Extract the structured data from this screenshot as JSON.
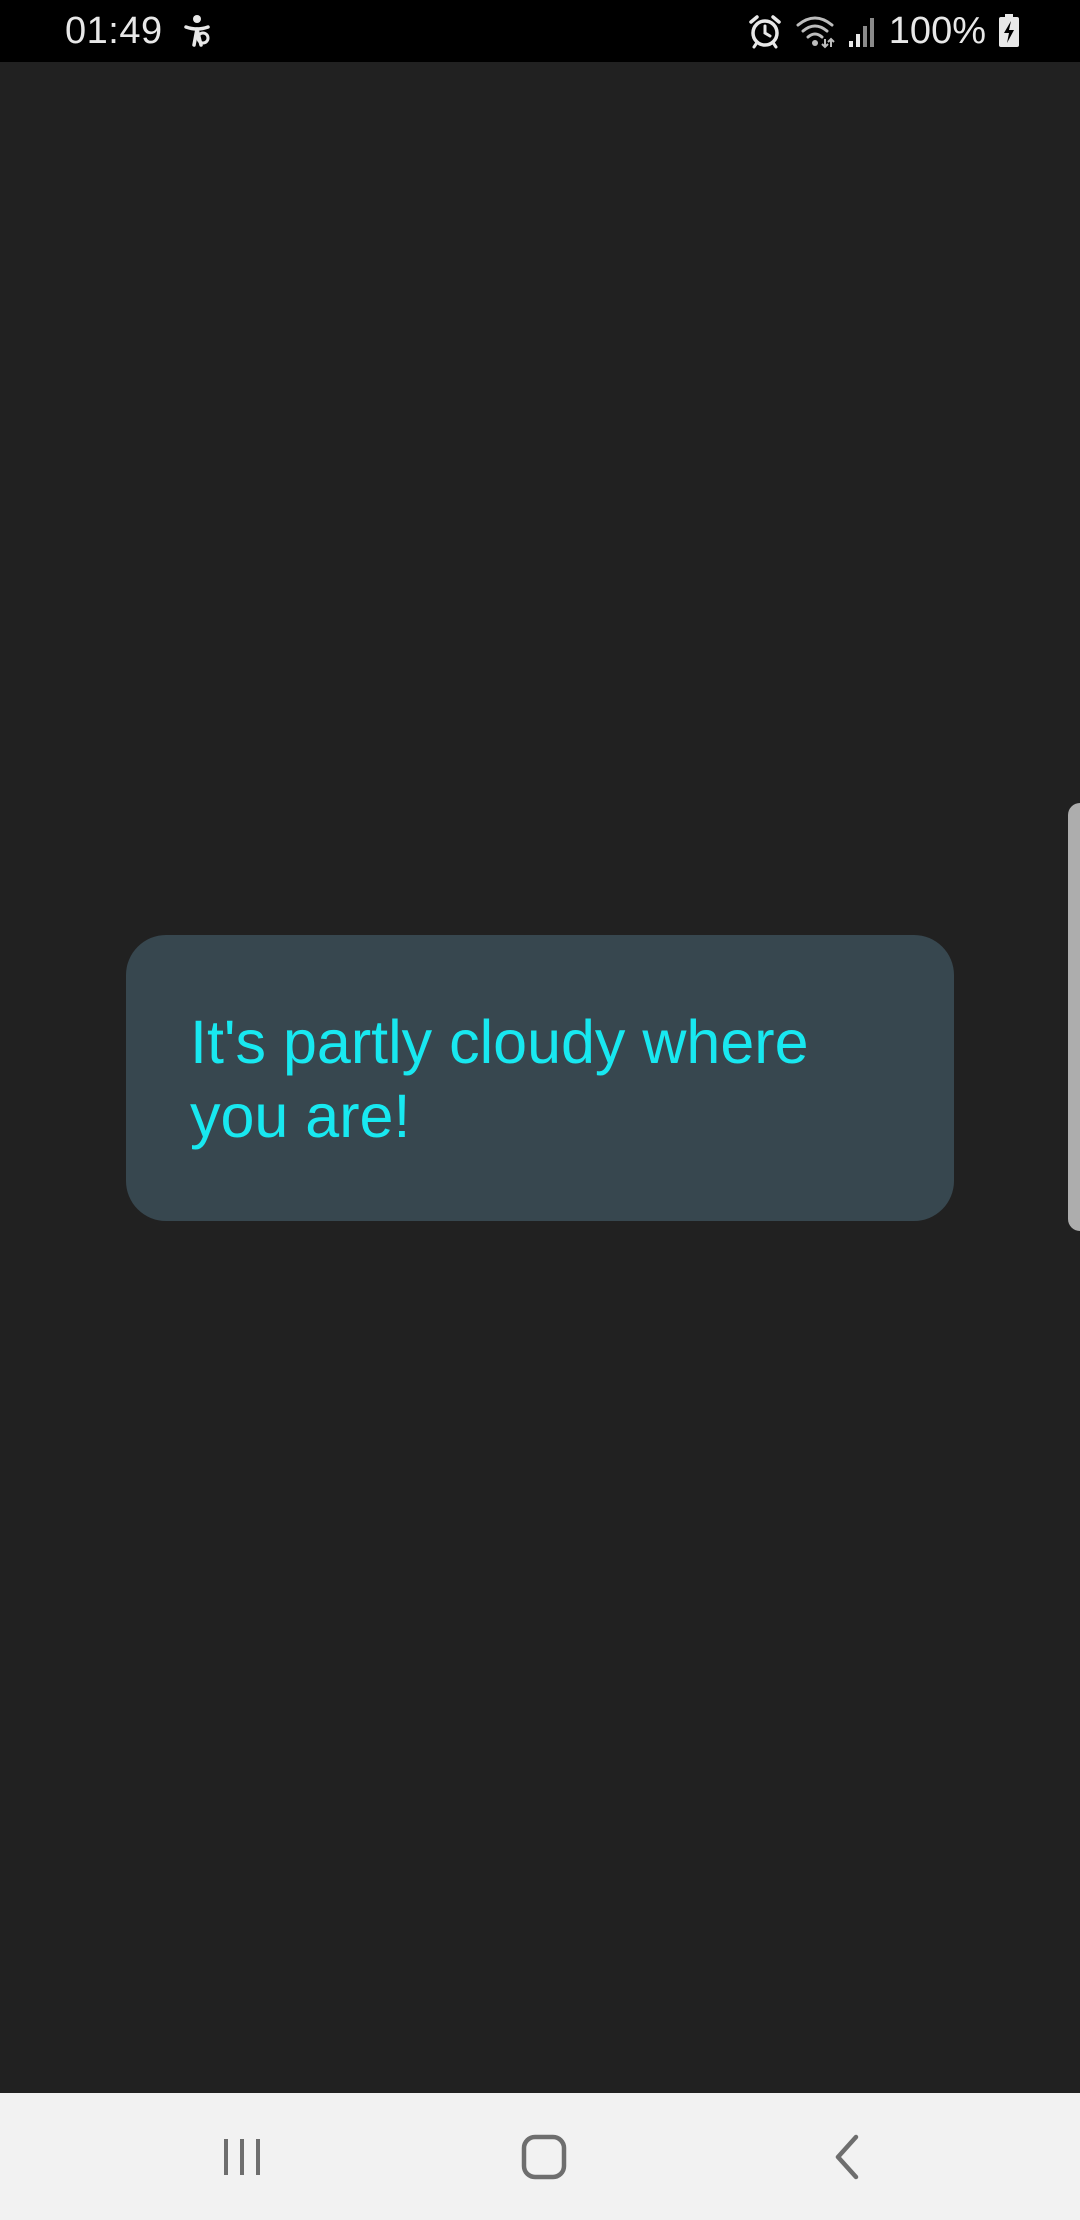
{
  "status_bar": {
    "time": "01:49",
    "left_icon": "accessibility-icon",
    "alarm_icon": "alarm-icon",
    "wifi_icon": "wifi-icon",
    "signal_icon": "cell-signal-icon",
    "battery_text": "100%",
    "battery_icon": "battery-charging-icon"
  },
  "message": {
    "text": "It's partly cloudy where you are!"
  },
  "nav_bar": {
    "recents_icon": "recents-icon",
    "home_icon": "home-icon",
    "back_icon": "back-icon"
  },
  "colors": {
    "background": "#212121",
    "card": "#37474f",
    "text_accent": "#18e8f0",
    "nav_bar": "#f2f2f2"
  }
}
